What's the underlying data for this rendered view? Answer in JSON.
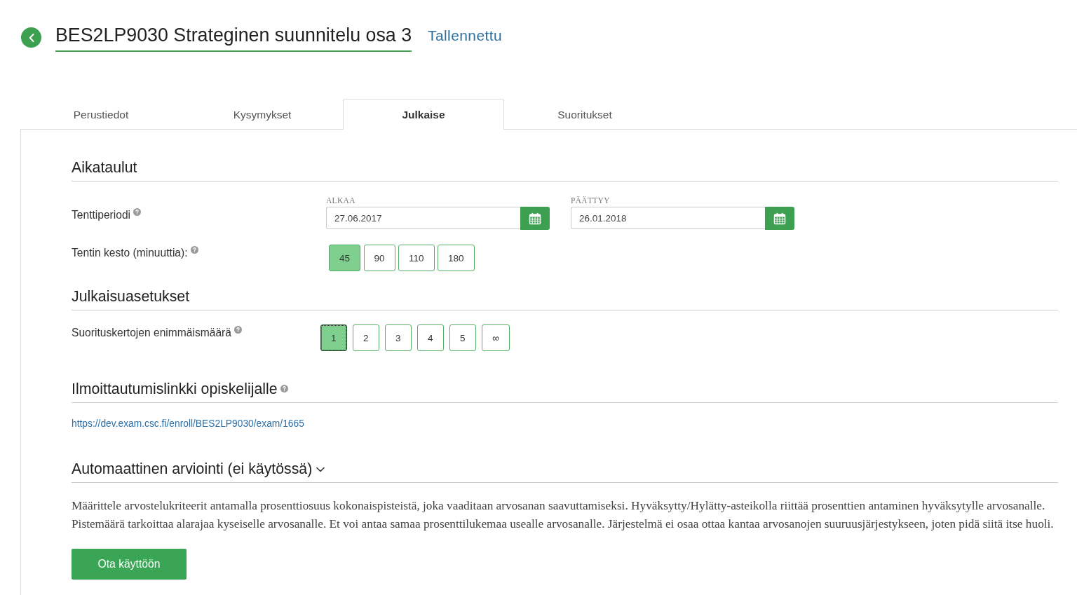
{
  "header": {
    "title": "BES2LP9030 Strateginen suunnitelu osa 3",
    "status": "Tallennettu"
  },
  "tabs": [
    {
      "label": "Perustiedot",
      "selected": false
    },
    {
      "label": "Kysymykset",
      "selected": false
    },
    {
      "label": "Julkaise",
      "selected": true
    },
    {
      "label": "Suoritukset",
      "selected": false
    }
  ],
  "schedule": {
    "title": "Aikataulut",
    "period": {
      "label": "Tenttiperiodi",
      "start": {
        "label": "ALKAA",
        "value": "27.06.2017"
      },
      "end": {
        "label": "PÄÄTTYY",
        "value": "26.01.2018"
      }
    },
    "duration": {
      "label": "Tentin kesto (minuuttia):",
      "options": [
        {
          "label": "45",
          "selected": true
        },
        {
          "label": "90",
          "selected": false
        },
        {
          "label": "110",
          "selected": false
        },
        {
          "label": "180",
          "selected": false
        }
      ]
    }
  },
  "publish_settings": {
    "title": "Julkaisuasetukset",
    "attempts": {
      "label": "Suorituskertojen enimmäismäärä",
      "options": [
        {
          "label": "1",
          "selected": true,
          "focused": true
        },
        {
          "label": "2",
          "selected": false,
          "focused": false
        },
        {
          "label": "3",
          "selected": false,
          "focused": false
        },
        {
          "label": "4",
          "selected": false,
          "focused": false
        },
        {
          "label": "5",
          "selected": false,
          "focused": false
        },
        {
          "label": "∞",
          "selected": false,
          "focused": false
        }
      ]
    }
  },
  "enrollment_link": {
    "title": "Ilmoittautumislinkki opiskelijalle",
    "url": "https://dev.exam.csc.fi/enroll/BES2LP9030/exam/1665"
  },
  "auto_evaluation": {
    "title": "Automaattinen arviointi (ei käytössä)",
    "expanded": true,
    "description": "Määrittele arvostelukriteerit antamalla prosenttiosuus kokonaispisteistä, joka vaaditaan arvosanan saavuttamiseksi. Hyväksytty/Hylätty-asteikolla riittää prosenttien antaminen hyväksytylle arvosanalle. Pistemäärä tarkoittaa alarajaa kyseiselle arvosanalle. Et voi antaa samaa prosenttilukemaa usealle arvosanalle. Järjestelmä ei osaa ottaa kantaa arvosanojen suuruusjärjestykseen, joten pidä siitä itse huoli.",
    "button": "Ota käyttöön"
  }
}
